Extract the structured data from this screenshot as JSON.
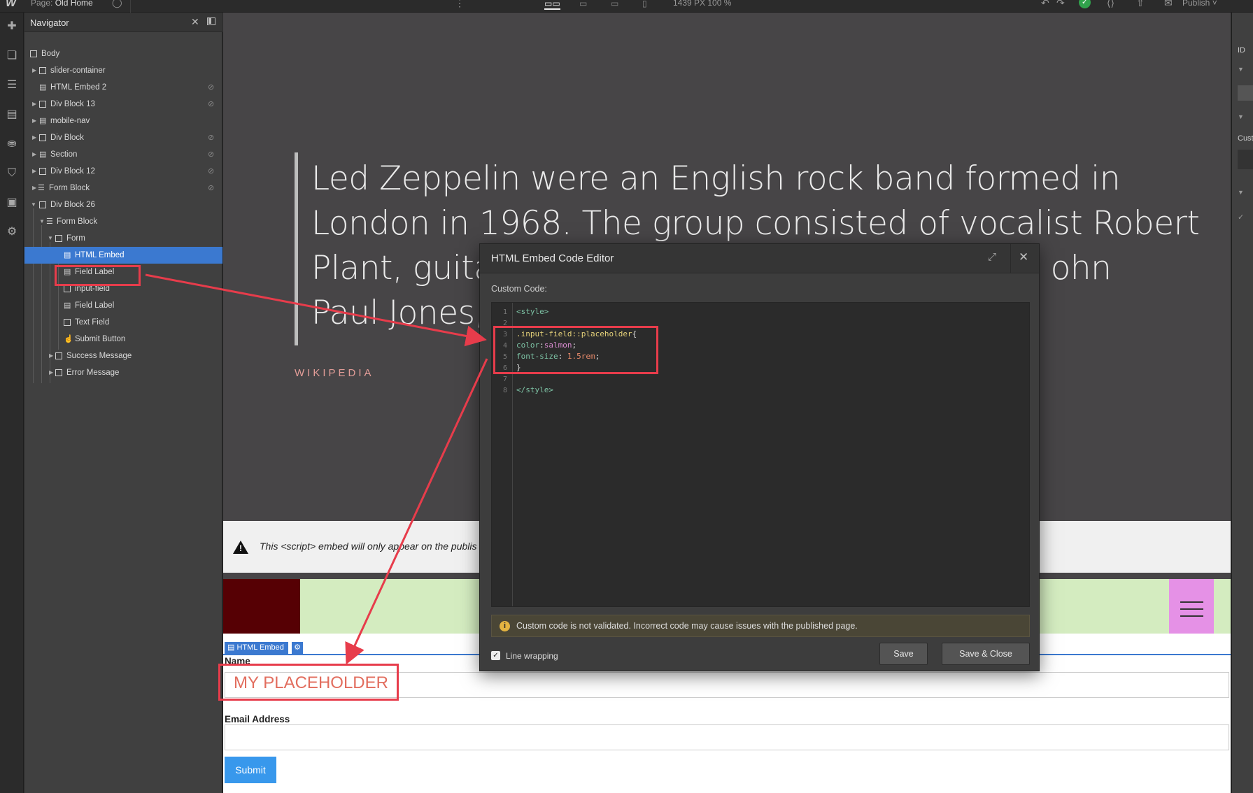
{
  "topbar": {
    "logo": "W",
    "page_prefix": "Page:",
    "page_name": "Old Home",
    "size_readout": "1439 PX  100 %",
    "publish_label": "Publish"
  },
  "navigator": {
    "title": "Navigator",
    "items": [
      {
        "label": "Body"
      },
      {
        "label": "slider-container"
      },
      {
        "label": "HTML Embed 2"
      },
      {
        "label": "Div Block 13"
      },
      {
        "label": "mobile-nav"
      },
      {
        "label": "Div Block"
      },
      {
        "label": "Section"
      },
      {
        "label": "Div Block 12"
      },
      {
        "label": "Form Block"
      },
      {
        "label": "Div Block 26"
      },
      {
        "label": "Form Block"
      },
      {
        "label": "Form"
      },
      {
        "label": "HTML Embed"
      },
      {
        "label": "Field Label"
      },
      {
        "label": "input-field"
      },
      {
        "label": "Field Label"
      },
      {
        "label": "Text Field"
      },
      {
        "label": "Submit Button"
      },
      {
        "label": "Success Message"
      },
      {
        "label": "Error Message"
      }
    ],
    "selected": "HTML Embed"
  },
  "canvas": {
    "quote": "Led Zeppelin were an English rock band formed in London in 1968. The group consisted of vocalist Robert Plant, guita                                  ohn Paul Jones,",
    "quote_line1": "Led Zeppelin were an English rock band formed in",
    "quote_line2": "London in 1968. The group consisted of vocalist Robert",
    "quote_line3a": "Plant, guita",
    "quote_line3b": "ohn",
    "quote_line4": "Paul Jones,",
    "source": "WIKIPEDIA",
    "notice": "This <script> embed will only appear on the publis",
    "embed_tag": "HTML Embed",
    "name_label": "Name",
    "placeholder": "MY PLACEHOLDER",
    "email_label": "Email Address",
    "submit_label": "Submit"
  },
  "right_panel": {
    "id_label": "ID",
    "cust_label": "Cust"
  },
  "modal": {
    "title": "HTML Embed Code Editor",
    "custom_code_label": "Custom Code:",
    "code_lines": [
      "<style>",
      "",
      ".input-field::placeholder{",
      "color:salmon;",
      "font-size: 1.5rem;",
      "}",
      "",
      "</style>"
    ],
    "line_numbers": [
      "1",
      "2",
      "3",
      "4",
      "5",
      "6",
      "7",
      "8"
    ],
    "code_tokens": {
      "l1": "<style>",
      "l3_sel": ".input-field::placeholder",
      "l3_pun": "{",
      "l4_prop": "color",
      "l4_pun": ":",
      "l4_val": "salmon",
      "l4_end": ";",
      "l5_prop": "font-size",
      "l5_pun": ": ",
      "l5_val": "1.5rem",
      "l5_end": ";",
      "l6": "}",
      "l8": "</style>"
    },
    "alert": "Custom code is not validated. Incorrect code may cause issues with the published page.",
    "line_wrapping_label": "Line wrapping",
    "line_wrapping_checked": true,
    "save_label": "Save",
    "save_close_label": "Save & Close"
  },
  "colors": {
    "selection_blue": "#3b79d0",
    "annotation_red": "#e73c4b",
    "placeholder_salmon": "#e26d5e",
    "submit_blue": "#3898ec"
  }
}
